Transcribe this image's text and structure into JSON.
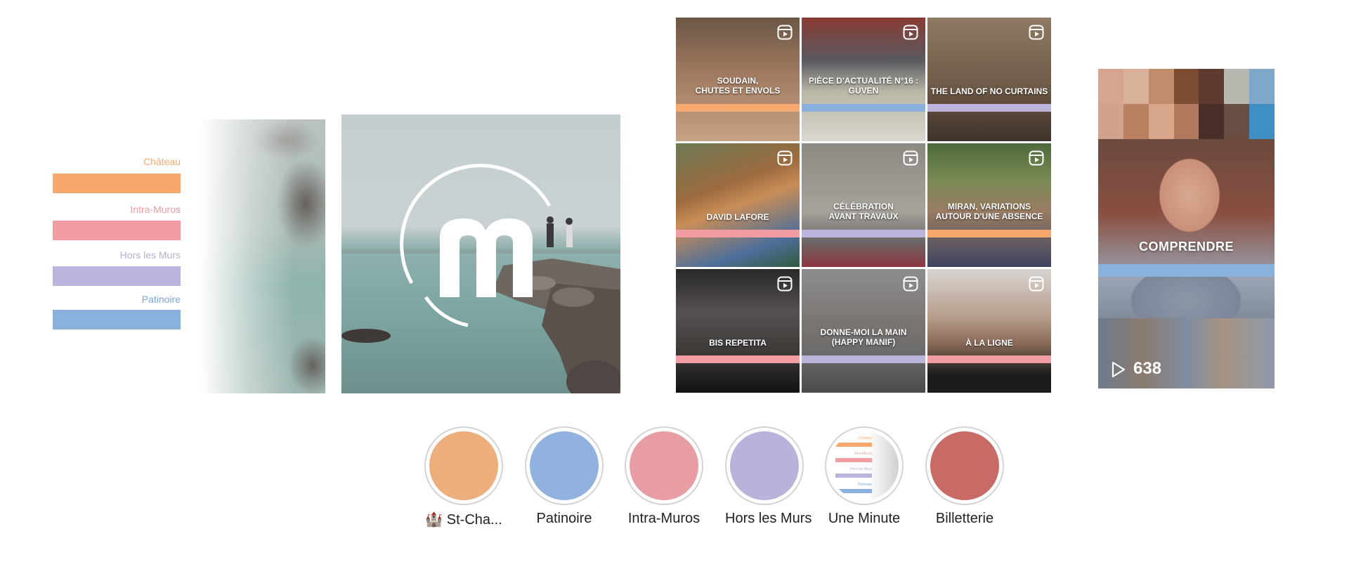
{
  "legend": {
    "items": [
      {
        "label": "Château",
        "color": "#f6a86e"
      },
      {
        "label": "Intra-Muros",
        "color": "#f29ca3"
      },
      {
        "label": "Hors les Murs",
        "color": "#bcb4dc"
      },
      {
        "label": "Patinoire",
        "color": "#8ab0de"
      }
    ]
  },
  "grid": {
    "tiles": [
      {
        "title": "SOUDAIN,\nCHUTES ET ENVOLS",
        "band_color": "#f6a86e",
        "icon": "reel-icon"
      },
      {
        "title": "PIÈCE D'ACTUALITÉ N°16 :\nGÜVEN",
        "band_color": "#8ab0de",
        "icon": "reel-icon"
      },
      {
        "title": "THE LAND OF NO CURTAINS",
        "band_color": "#bcb4dc",
        "icon": "reel-icon"
      },
      {
        "title": "DAVID LAFORE",
        "band_color": "#f29ca3",
        "icon": "reel-icon"
      },
      {
        "title": "CÉLÉBRATION\nAVANT TRAVAUX",
        "band_color": "#bcb4dc",
        "icon": "reel-icon"
      },
      {
        "title": "MIRAN, VARIATIONS\nAUTOUR D'UNE ABSENCE",
        "band_color": "#f6a86e",
        "icon": "reel-icon"
      },
      {
        "title": "BIS REPETITA",
        "band_color": "#f29ca3",
        "icon": "reel-icon"
      },
      {
        "title": "DONNE-MOI LA MAIN\n(HAPPY MANIF)",
        "band_color": "#bcb4dc",
        "icon": "reel-icon"
      },
      {
        "title": "À LA LIGNE",
        "band_color": "#f29ca3",
        "icon": "reel-icon"
      }
    ]
  },
  "story": {
    "title": "COMPRENDRE",
    "band_color": "#8ab0de",
    "views": "638",
    "icon": "play-icon"
  },
  "highlights": [
    {
      "label": "🏰 St-Cha...",
      "color": "#ecae7b"
    },
    {
      "label": "Patinoire",
      "color": "#91b2de"
    },
    {
      "label": "Intra-Muros",
      "color": "#e89ca4"
    },
    {
      "label": "Hors les Murs",
      "color": "#bab2da"
    },
    {
      "label": "Une Minute",
      "color": "#ffffff"
    },
    {
      "label": "Billetterie",
      "color": "#c86b66"
    }
  ],
  "une_minute_thumb": {
    "lines": [
      "Château",
      "Intra-Muros",
      "Hors les Murs",
      "Patinoire"
    ]
  }
}
